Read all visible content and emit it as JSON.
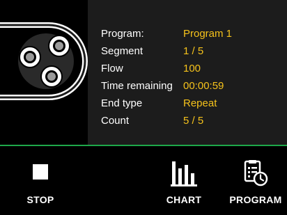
{
  "pump": {
    "icon": "peristaltic-pump-icon"
  },
  "info": {
    "rows": [
      {
        "label": "Program:",
        "value": "Program 1"
      },
      {
        "label": "Segment",
        "value": "1 / 5"
      },
      {
        "label": "Flow",
        "value": "100"
      },
      {
        "label": "Time remaining",
        "value": "00:00:59"
      },
      {
        "label": "End type",
        "value": "Repeat"
      },
      {
        "label": "Count",
        "value": "5 / 5"
      }
    ]
  },
  "actions": {
    "stop": {
      "label": "STOP",
      "icon": "stop-icon"
    },
    "chart": {
      "label": "CHART",
      "icon": "bar-chart-icon"
    },
    "program": {
      "label": "PROGRAM",
      "icon": "program-clock-icon"
    }
  },
  "colors": {
    "background": "#000000",
    "info_panel": "#1c1c1c",
    "value_text": "#f5c21b",
    "label_text": "#ffffff",
    "divider": "#1ea84a"
  }
}
